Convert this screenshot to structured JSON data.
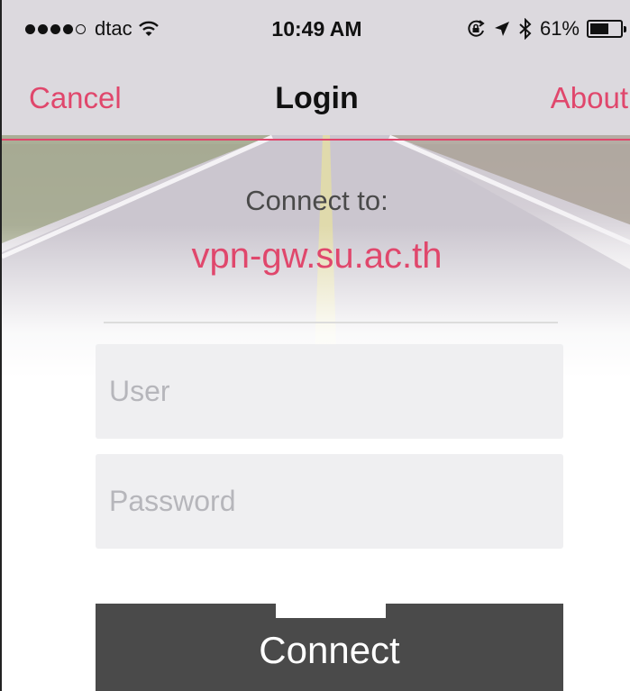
{
  "status_bar": {
    "carrier": "dtac",
    "time": "10:49 AM",
    "battery": "61%",
    "battery_level": 0.61,
    "signal_bars_filled": 4,
    "signal_bars_total": 5,
    "icons": [
      "wifi-icon",
      "rotation-lock-icon",
      "location-icon",
      "bluetooth-icon",
      "battery-icon"
    ]
  },
  "nav": {
    "left_button": "Cancel",
    "title": "Login",
    "right_button": "About"
  },
  "connect": {
    "label": "Connect to:",
    "host": "vpn-gw.su.ac.th"
  },
  "form": {
    "user_placeholder": "User",
    "user_value": "",
    "password_placeholder": "Password",
    "password_value": "",
    "submit_label": "Connect"
  },
  "colors": {
    "accent": "#e0476c",
    "button_bg": "#4a4a4a",
    "field_bg": "#efeff1"
  }
}
